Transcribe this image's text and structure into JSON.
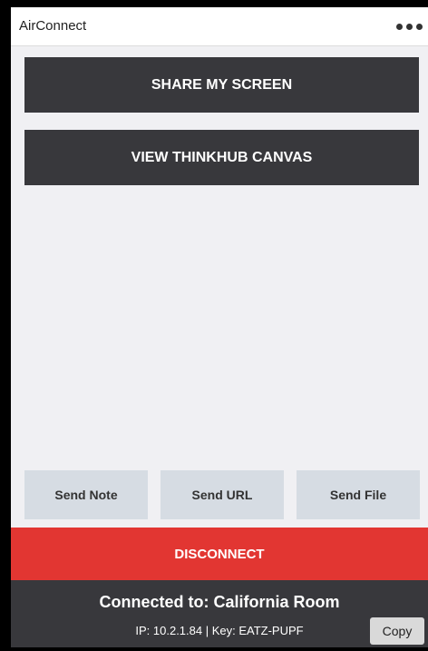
{
  "app": {
    "title": "AirConnect",
    "menu_icon": "more-horizontal-icon"
  },
  "actions": {
    "share_label": "SHARE MY SCREEN",
    "view_label": "VIEW THINKHUB CANVAS"
  },
  "send": {
    "note_label": "Send Note",
    "url_label": "Send URL",
    "file_label": "Send File"
  },
  "disconnect_label": "DISCONNECT",
  "status": {
    "connected_text": "Connected to: California Room",
    "ip_line": "IP: 10.2.1.84 | Key: EATZ-PUPF",
    "copy_label": "Copy"
  },
  "colors": {
    "dark_button": "#38383c",
    "disconnect": "#e23632",
    "send_button": "#d6dce3",
    "background": "#f0f0f3"
  }
}
